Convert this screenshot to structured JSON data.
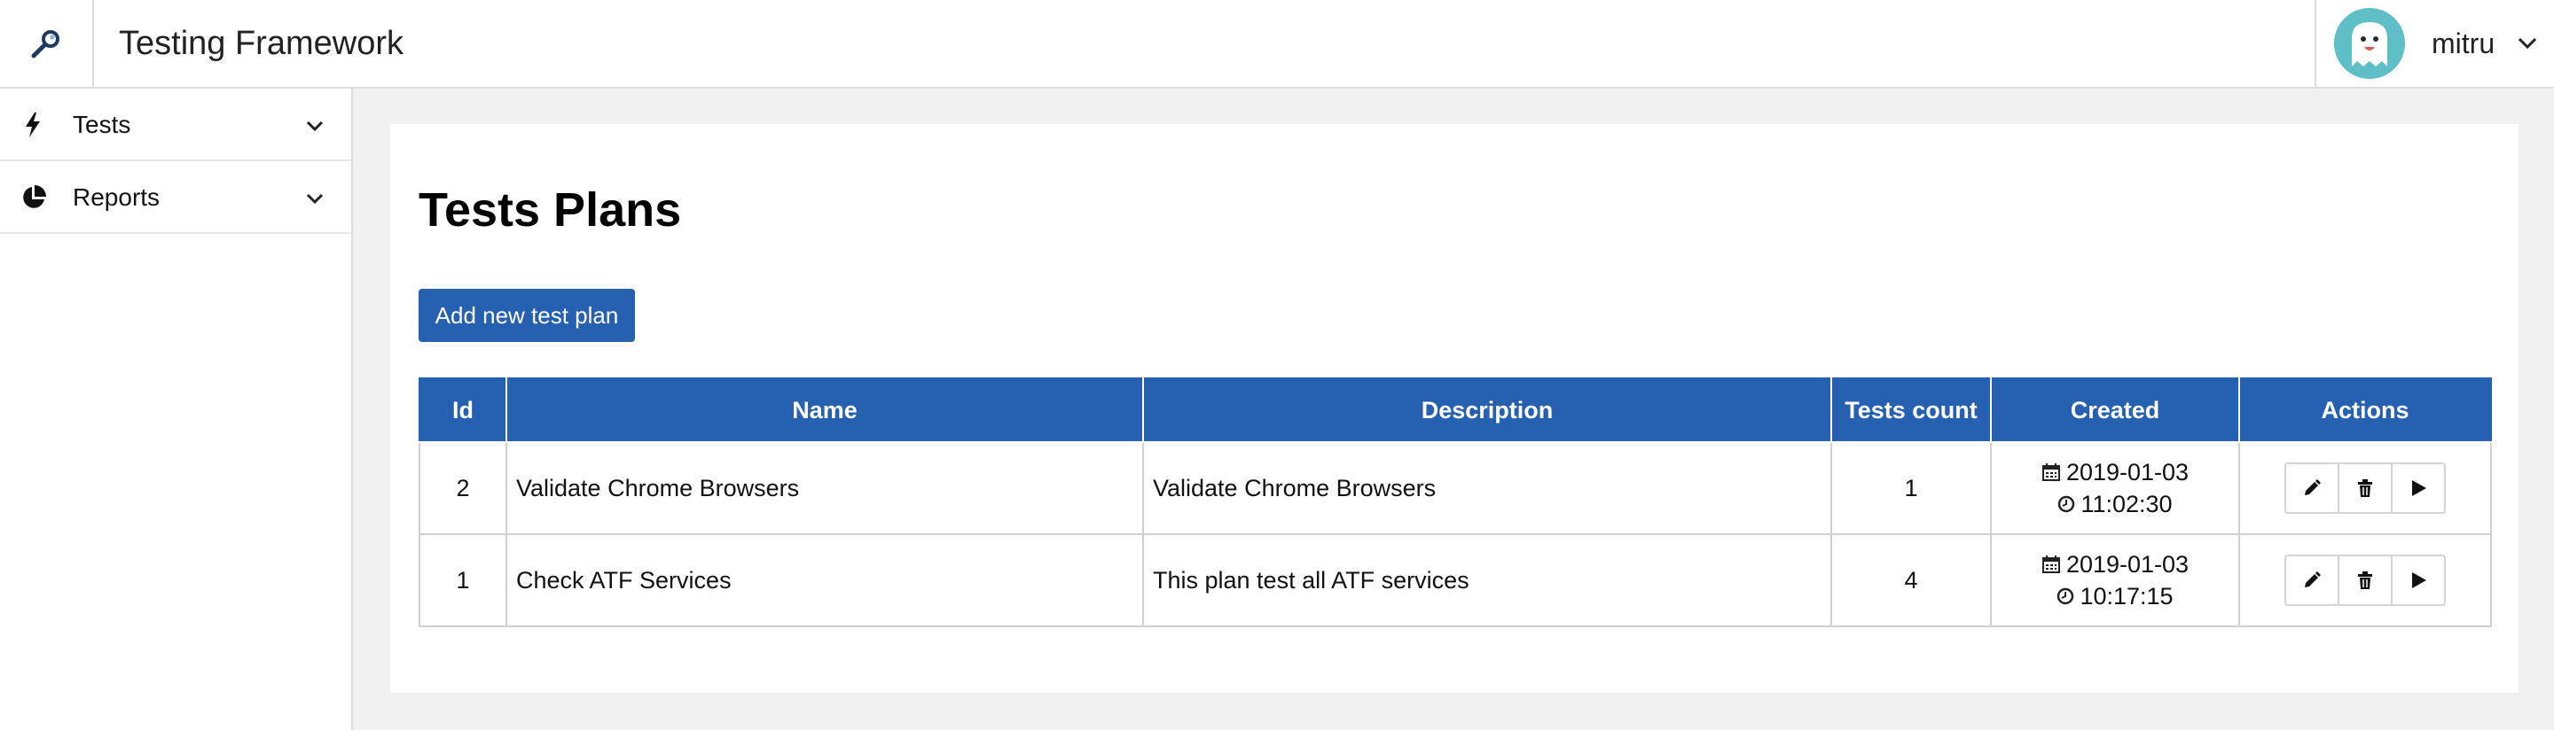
{
  "header": {
    "app_title": "Testing Framework",
    "username": "mitru",
    "brand_icon": "magnifier-icon",
    "accent_color": "#2660b0"
  },
  "sidebar": {
    "items": [
      {
        "label": "Tests",
        "icon": "bolt-icon"
      },
      {
        "label": "Reports",
        "icon": "pie-chart-icon"
      }
    ]
  },
  "main": {
    "title": "Tests Plans",
    "add_button_label": "Add new test plan",
    "table": {
      "columns": [
        "Id",
        "Name",
        "Description",
        "Tests count",
        "Created",
        "Actions"
      ],
      "rows": [
        {
          "id": "2",
          "name": "Validate Chrome Browsers",
          "description": "Validate Chrome Browsers",
          "tests_count": "1",
          "created_date": "2019-01-03",
          "created_time": "11:02:30"
        },
        {
          "id": "1",
          "name": "Check ATF Services",
          "description": "This plan test all ATF services",
          "tests_count": "4",
          "created_date": "2019-01-03",
          "created_time": "10:17:15"
        }
      ]
    }
  }
}
